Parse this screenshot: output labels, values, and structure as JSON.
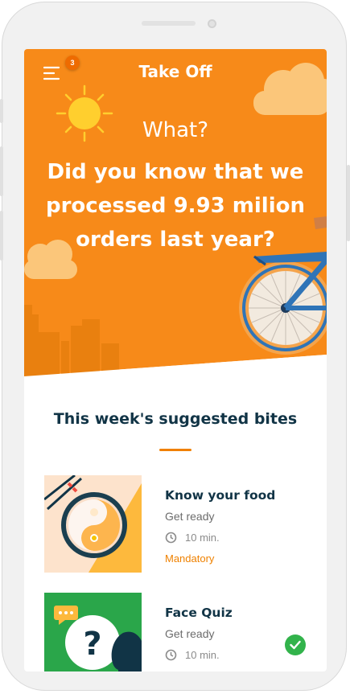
{
  "header": {
    "title": "Take Off",
    "menu_badge": "3"
  },
  "hero": {
    "kicker": "What?",
    "fact": "Did you know that we processed 9.93 milion orders last year?"
  },
  "section": {
    "title": "This week's suggested bites"
  },
  "bites": [
    {
      "title": "Know your food",
      "subtitle": "Get ready",
      "duration": "10 min.",
      "tag": "Mandatory"
    },
    {
      "title": "Face Quiz",
      "subtitle": "Get ready",
      "duration": "10 min."
    }
  ],
  "colors": {
    "hero_orange": "#f78a19",
    "accent": "#ef8100",
    "title_navy": "#113446",
    "check_green": "#32b34b",
    "quiz_green": "#2aa64a"
  },
  "icons": [
    "menu-icon",
    "sun-icon",
    "cloud-icon",
    "bicycle-icon",
    "clock-icon",
    "chopsticks-icon",
    "question-icon",
    "chat-bubble-icon",
    "check-icon"
  ]
}
